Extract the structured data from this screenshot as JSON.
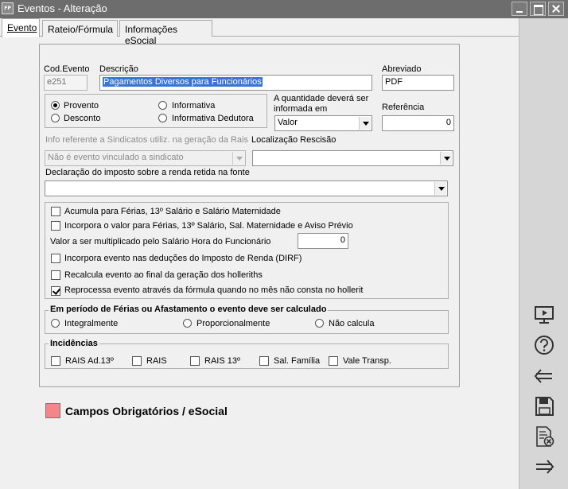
{
  "window": {
    "app_icon_text": "FP",
    "title": "Eventos - Alteração"
  },
  "tabs": [
    {
      "label": "Evento",
      "active": true
    },
    {
      "label": "Rateio/Fórmula",
      "active": false
    },
    {
      "label": "Informações eSocial",
      "active": false
    }
  ],
  "form": {
    "cod_evento_label": "Cod.Evento",
    "cod_evento_value": "e251",
    "descricao_label": "Descrição",
    "descricao_value": "Pagamentos Diversos para Funcionários",
    "abreviado_label": "Abreviado",
    "abreviado_value": "PDF",
    "tipo_options": {
      "provento": "Provento",
      "desconto": "Desconto",
      "informativa": "Informativa",
      "informativa_dedutora": "Informativa Dedutora"
    },
    "tipo_selected": "Provento",
    "quantidade_label": "A quantidade deverá ser informada em",
    "quantidade_value": "Valor",
    "referencia_label": "Referência",
    "referencia_value": "0",
    "sindicato_label": "Info referente a Sindicatos utiliz. na geração da Rais",
    "sindicato_value": "Não é evento vinculado a sindicato",
    "rescisao_label": "Localização Rescisão",
    "rescisao_value": "",
    "dirf_decl_label": "Declaração do imposto sobre a renda retida na fonte",
    "dirf_decl_value": ""
  },
  "options": {
    "acumula_ferias": {
      "label": "Acumula para Férias, 13º Salário e Salário Maternidade",
      "checked": false
    },
    "incorpora_valor": {
      "label": "Incorpora o valor para Férias, 13º Salário, Sal. Maternidade e Aviso Prévio",
      "checked": false
    },
    "multiplicador_label": "Valor a ser multiplicado pelo Salário Hora do Funcionário",
    "multiplicador_value": "0",
    "incorpora_irrf": {
      "label": "Incorpora evento nas deduções do Imposto de Renda (DIRF)",
      "checked": false
    },
    "recalcula": {
      "label": "Recalcula evento ao final da geração dos holleriths",
      "checked": false
    },
    "reprocessa": {
      "label": "Reprocessa evento através da fórmula quando no mês não consta no hollerit",
      "checked": true
    }
  },
  "ferias_group": {
    "title": "Em período de Férias ou Afastamento o evento deve ser calculado",
    "options": [
      "Integralmente",
      "Proporcionalmente",
      "Não calcula"
    ],
    "selected": ""
  },
  "incidencias": {
    "title": "Incidências",
    "items": [
      "RAIS Ad.13º",
      "RAIS",
      "RAIS 13º",
      "Sal. Família",
      "Vale Transp."
    ]
  },
  "legend": {
    "text": "Campos Obrigatórios / eSocial",
    "color": "#f4858a"
  },
  "sidebar": {
    "buttons": [
      "presentation-icon",
      "help-icon",
      "back-arrow-icon",
      "save-icon",
      "cancel-document-icon",
      "forward-arrow-icon"
    ]
  }
}
